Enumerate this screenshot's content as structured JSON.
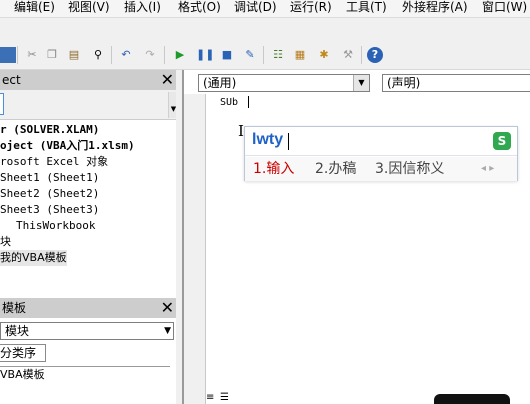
{
  "menu": [
    "编辑(E)",
    "视图(V)",
    "插入(I)",
    "格式(O)",
    "调试(D)",
    "运行(R)",
    "工具(T)",
    "外接程序(A)",
    "窗口(W)"
  ],
  "project_panel": {
    "title": "ect",
    "tree": [
      "r (SOLVER.XLAM)",
      "oject (VBA入门1.xlsm)",
      "rosoft Excel 对象",
      "Sheet1 (Sheet1)",
      "Sheet2 (Sheet2)",
      "Sheet3 (Sheet3)",
      "ThisWorkbook",
      "块",
      "我的VBA模板"
    ]
  },
  "properties_panel": {
    "title": "模板",
    "object_select": "模块",
    "tab": "分类序",
    "row_label": "VBA模板"
  },
  "editor": {
    "object_combo": "(通用)",
    "proc_combo": "(声明)",
    "code_line": "SUb"
  },
  "ime": {
    "input": "lwty",
    "logo_text": "S",
    "candidates": [
      "1.输入",
      "2.办稿",
      "3.因信称义"
    ],
    "nav": "◂ ▸",
    "accent_color": "#cc0000"
  }
}
